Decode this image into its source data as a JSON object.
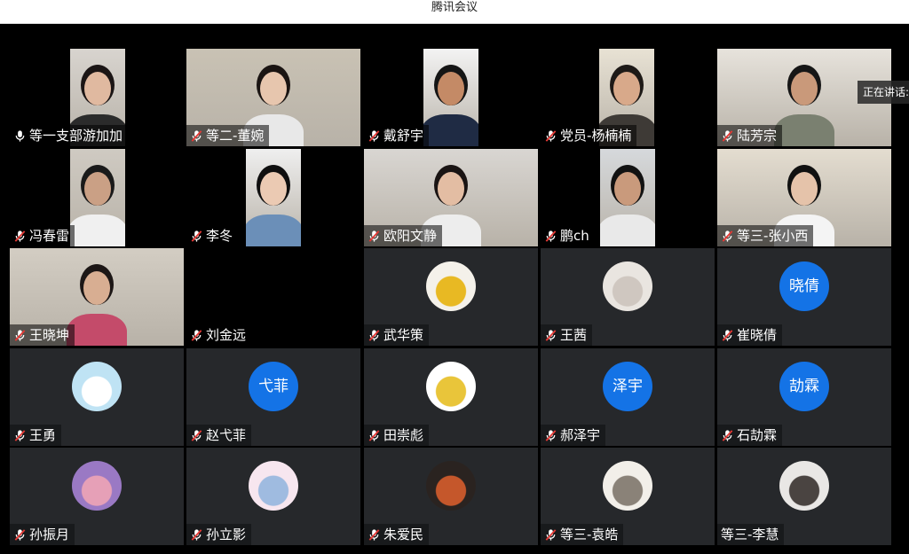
{
  "window": {
    "title": "腾讯会议"
  },
  "speaking_indicator": "正在讲话:",
  "colors": {
    "background": "#000000",
    "tile_empty": "#26282b",
    "avatar_blue": "#1473e6",
    "mic_muted": "#e53935"
  },
  "participants": [
    {
      "name": "等一支部游加加",
      "mic": "on",
      "type": "video"
    },
    {
      "name": "等二-董婉",
      "mic": "muted",
      "type": "video"
    },
    {
      "name": "戴舒宇",
      "mic": "muted",
      "type": "video"
    },
    {
      "name": "党员-杨楠楠",
      "mic": "muted",
      "type": "video"
    },
    {
      "name": "陆芳宗",
      "mic": "muted",
      "type": "video"
    },
    {
      "name": "冯春雷",
      "mic": "muted",
      "type": "video"
    },
    {
      "name": "李冬",
      "mic": "muted",
      "type": "video"
    },
    {
      "name": "欧阳文静",
      "mic": "muted",
      "type": "video"
    },
    {
      "name": "鹏ch",
      "mic": "muted",
      "type": "video"
    },
    {
      "name": "等三-张小西",
      "mic": "muted",
      "type": "video"
    },
    {
      "name": "王晓坤",
      "mic": "muted",
      "type": "video"
    },
    {
      "name": "刘金远",
      "mic": "muted",
      "type": "video-off"
    },
    {
      "name": "武华策",
      "mic": "muted",
      "type": "avatar-image",
      "avatar": "boy-photo-avatar"
    },
    {
      "name": "王茜",
      "mic": "muted",
      "type": "avatar-image",
      "avatar": "girl-with-bunny-avatar"
    },
    {
      "name": "崔晓倩",
      "mic": "muted",
      "type": "avatar-text",
      "avatar_text": "晓倩"
    },
    {
      "name": "王勇",
      "mic": "muted",
      "type": "avatar-image",
      "avatar": "cartoon-robots-avatar"
    },
    {
      "name": "赵弋菲",
      "mic": "muted",
      "type": "avatar-text",
      "avatar_text": "弋菲"
    },
    {
      "name": "田崇彪",
      "mic": "muted",
      "type": "avatar-image",
      "avatar": "pineapple-avatar"
    },
    {
      "name": "郝泽宇",
      "mic": "muted",
      "type": "avatar-text",
      "avatar_text": "泽宇"
    },
    {
      "name": "石劼霖",
      "mic": "muted",
      "type": "avatar-text",
      "avatar_text": "劼霖"
    },
    {
      "name": "孙振月",
      "mic": "muted",
      "type": "avatar-image",
      "avatar": "anime-girl-avatar"
    },
    {
      "name": "孙立影",
      "mic": "muted",
      "type": "avatar-image",
      "avatar": "milk-carton-avatar"
    },
    {
      "name": "朱爱民",
      "mic": "muted",
      "type": "avatar-image",
      "avatar": "canyon-landscape-avatar"
    },
    {
      "name": "等三-袁皓",
      "mic": "muted",
      "type": "avatar-image",
      "avatar": "sketch-portrait-avatar"
    },
    {
      "name": "等三-李慧",
      "mic": "none",
      "type": "avatar-image",
      "avatar": "husky-dog-avatar"
    }
  ]
}
